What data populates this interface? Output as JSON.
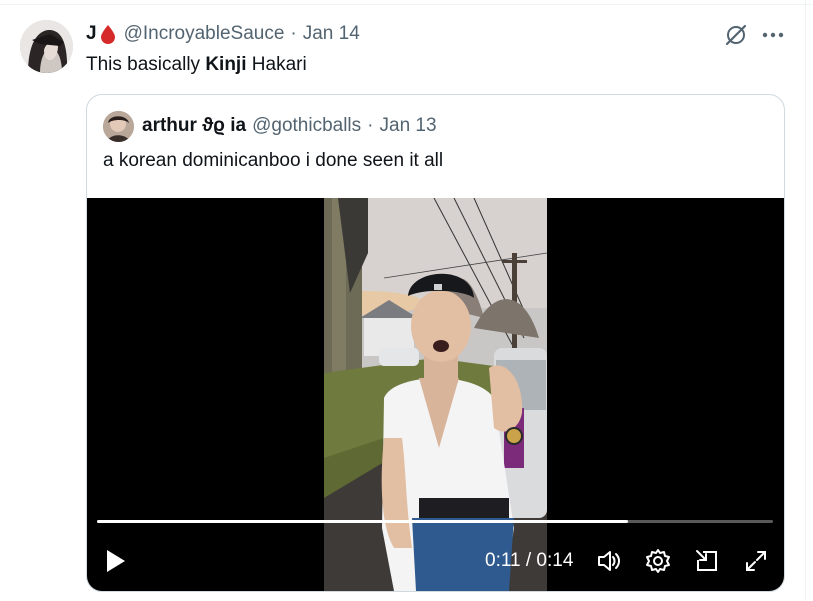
{
  "tweet": {
    "author_name": "J",
    "author_handle": "@IncroyableSauce",
    "separator": "·",
    "date": "Jan 14",
    "text_part1": "This basically ",
    "text_bold": "Kinji",
    "text_part2": " Hakari"
  },
  "quote": {
    "author_name": "arthur ϑϱ ia",
    "author_handle": "@gothicballs",
    "separator": "·",
    "date": "Jan 13",
    "text": "a korean dominicanboo i done seen it all"
  },
  "video": {
    "current_time": "0:11",
    "separator": " / ",
    "duration": "0:14",
    "progress_fraction": 0.786
  },
  "icons": {
    "author_badge": "blood-drop-icon",
    "grok": "grok-icon",
    "more": "more-icon",
    "play": "play-icon",
    "volume": "volume-icon",
    "settings": "settings-icon",
    "pip": "picture-in-picture-icon",
    "fullscreen": "fullscreen-icon"
  },
  "colors": {
    "secondary_text": "#536471",
    "border": "#cfd9de",
    "drop": "#e0245e"
  }
}
